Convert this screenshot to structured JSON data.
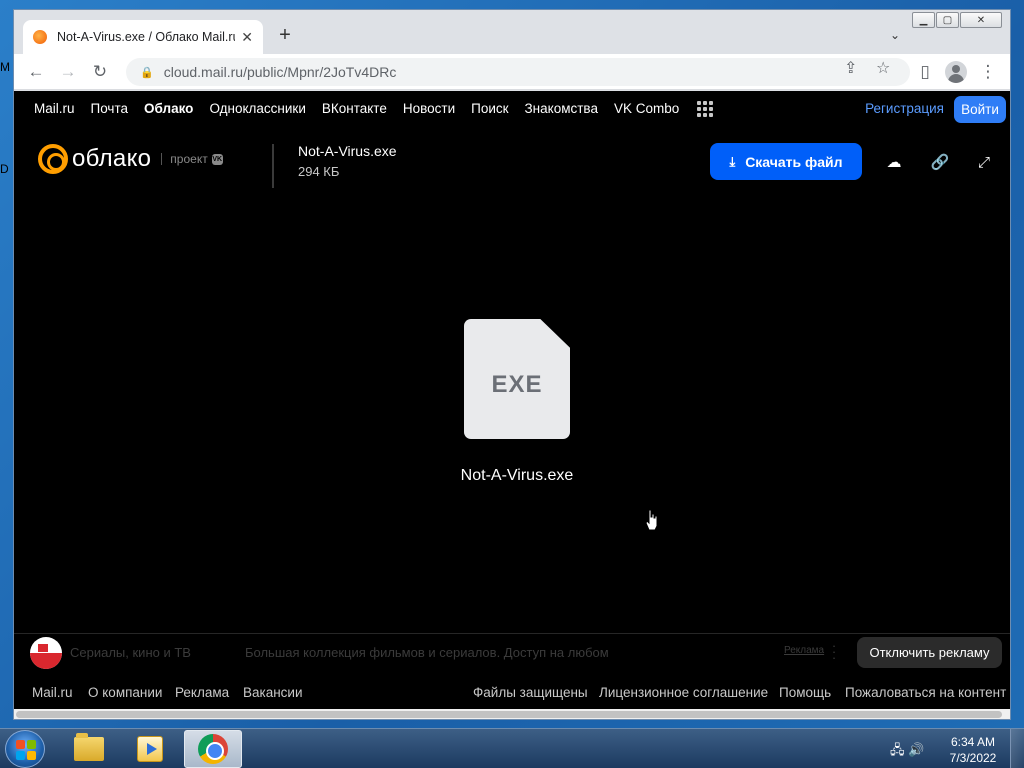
{
  "window": {
    "tab_title": "Not-A-Virus.exe / Облако Mail.ru",
    "tab_close": "✕",
    "new_tab": "+",
    "url": "cloud.mail.ru/public/Mpnr/2JoTv4DRc"
  },
  "portal_nav": {
    "items": [
      "Mail.ru",
      "Почта",
      "Облако",
      "Одноклассники",
      "ВКонтакте",
      "Новости",
      "Поиск",
      "Знакомства",
      "VK Combo"
    ],
    "register": "Регистрация",
    "login": "Войти"
  },
  "header": {
    "logo_text": "облако",
    "logo_project": "проект",
    "logo_vk": "VK",
    "file_name": "Not-A-Virus.exe",
    "file_size": "294 КБ",
    "download_label": "Скачать файл"
  },
  "file_preview": {
    "extension": "EXE",
    "name": "Not-A-Virus.exe"
  },
  "ad": {
    "title": "Сериалы, кино и ТВ",
    "text": "Большая коллекция фильмов и сериалов. Доступ на любом",
    "label": "Реклама",
    "disable": "Отключить рекламу"
  },
  "footer": {
    "left": [
      "Mail.ru",
      "О компании",
      "Реклама",
      "Вакансии"
    ],
    "right": [
      "Файлы защищены",
      "Лицензионное соглашение",
      "Помощь",
      "Пожаловаться на контент"
    ]
  },
  "taskbar": {
    "time": "6:34 AM",
    "date": "7/3/2022"
  },
  "desktop": {
    "frag1": "M",
    "frag2": "D"
  },
  "colors": {
    "accent": "#005ff9",
    "link": "#5b9cff",
    "logo": "#ff9e00"
  }
}
